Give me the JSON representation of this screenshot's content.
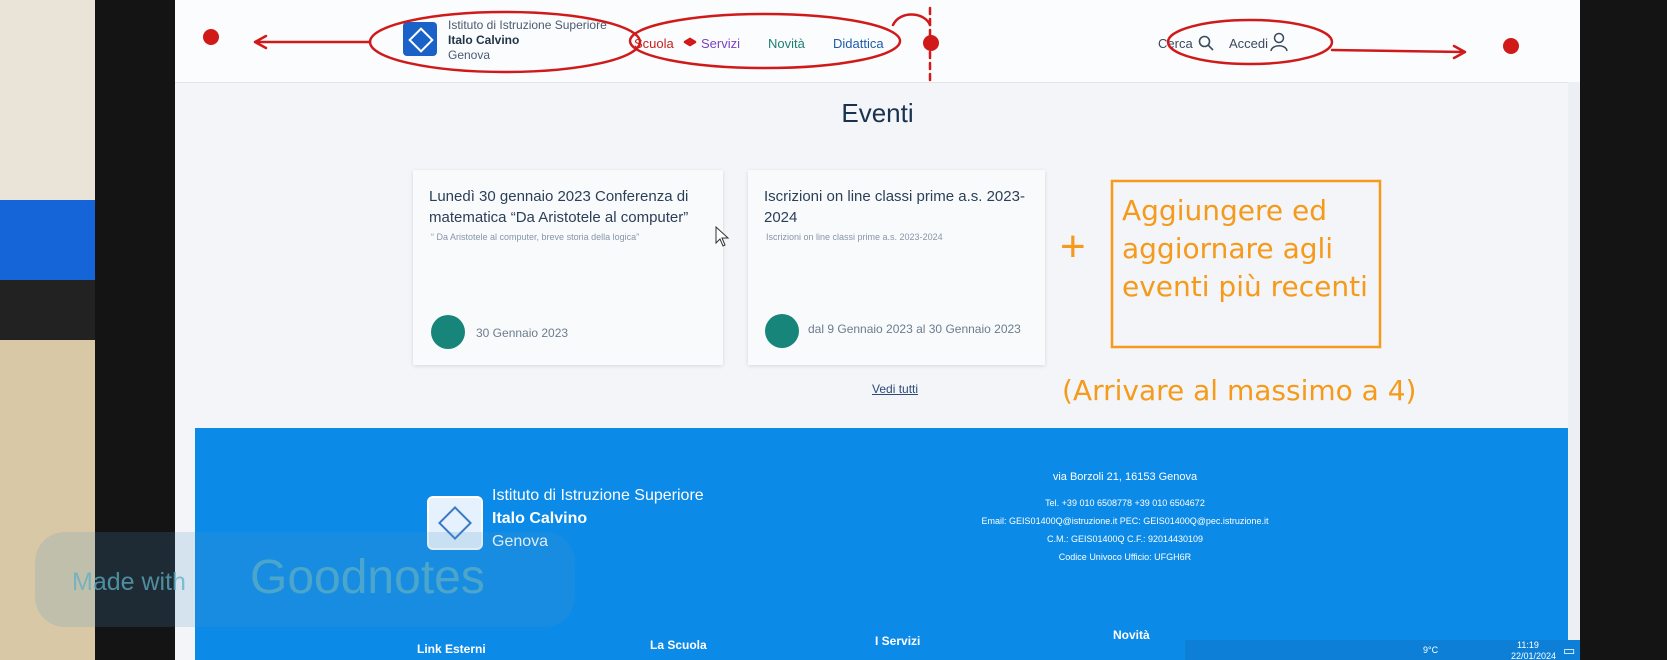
{
  "header": {
    "institute_line1": "Istituto di Istruzione Superiore",
    "institute_line2": "Italo Calvino",
    "institute_line3": "Genova",
    "nav": [
      "Scuola",
      "Servizi",
      "Novità",
      "Didattica"
    ],
    "search_label": "Cerca",
    "login_label": "Accedi"
  },
  "events": {
    "title": "Eventi",
    "cards": [
      {
        "title": "Lunedì 30 gennaio 2023 Conferenza di matematica “Da Aristotele al computer”",
        "subtitle": "“ Da Aristotele al computer, breve storia della logica”",
        "date": "30 Gennaio 2023"
      },
      {
        "title": "Iscrizioni on line classi prime a.s. 2023-2024",
        "subtitle": "Iscrizioni on line classi prime a.s. 2023-2024",
        "date": "dal 9 Gennaio 2023 al 30 Gennaio 2023"
      }
    ],
    "see_all": "Vedi tutti"
  },
  "annotations": {
    "plus": "+",
    "note_line1": "Aggiungere ed",
    "note_line2": "aggiornare agli",
    "note_line3": "eventi più recenti",
    "note2": "(Arrivare al massimo a 4)"
  },
  "footer": {
    "institute_line1": "Istituto di Istruzione Superiore",
    "institute_line2": "Italo Calvino",
    "institute_line3": "Genova",
    "address": "via Borzoli 21, 16153 Genova",
    "phone": "Tel. +39 010 6508778 +39 010 6504672",
    "email": "Email: GEIS01400Q@istruzione.it PEC: GEIS01400Q@pec.istruzione.it",
    "codes": "C.M.: GEIS01400Q C.F.: 92014430109",
    "office": "Codice Univoco Ufficio: UFGH6R",
    "headings": [
      "Link Esterni",
      "La Scuola",
      "I Servizi",
      "Novità"
    ]
  },
  "taskbar": {
    "weather": "9°C",
    "time": "11:19",
    "date": "22/01/2024"
  },
  "watermark": {
    "prefix": "Made with",
    "brand": "Goodnotes"
  },
  "colors": {
    "annotation_red": "#d01a1a",
    "annotation_orange": "#f59a1a",
    "footer_blue": "#0b8ae7"
  }
}
